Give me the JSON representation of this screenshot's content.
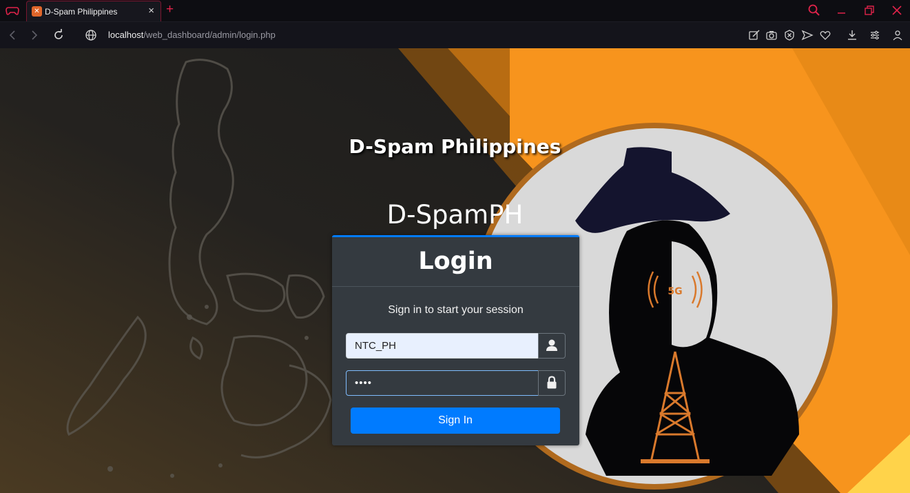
{
  "browser": {
    "tab_title": "D-Spam Philippines",
    "tab_close": "×",
    "new_tab": "+",
    "url_host": "localhost",
    "url_path": "/web_dashboard/admin/login.php"
  },
  "page": {
    "brand_name": "D-Spam Philippines",
    "brand_code": "D-SpamPH",
    "logo_badge_text": "5G"
  },
  "login": {
    "heading": "Login",
    "message": "Sign in to start your session",
    "username_value": "NTC_PH",
    "password_value": "••••",
    "signin_label": "Sign In"
  },
  "colors": {
    "accent": "#007bff",
    "card": "#343a40",
    "orange": "#f7941d",
    "browser_red": "#e0234a"
  },
  "icons": [
    "gx-controller-icon",
    "xampp-favicon",
    "close-icon",
    "plus-icon",
    "search-icon",
    "minimize-icon",
    "restore-icon",
    "window-close-icon",
    "back-icon",
    "forward-icon",
    "reload-icon",
    "globe-icon",
    "edit-icon",
    "camera-icon",
    "shield-icon",
    "send-icon",
    "heart-icon",
    "download-icon",
    "settings-icon",
    "profile-icon",
    "user-icon",
    "lock-icon"
  ]
}
